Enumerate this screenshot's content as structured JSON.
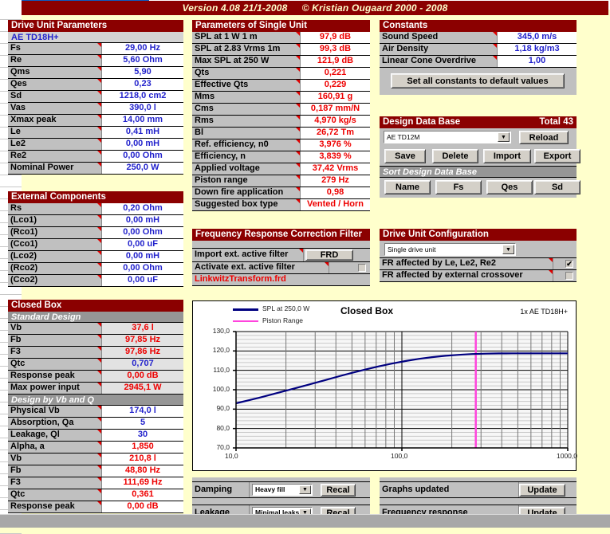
{
  "titlebar": {
    "version": "Version 4.08  21/1-2008",
    "copyright": "©  Kristian Ougaard  2000 - 2008"
  },
  "drive_unit_parameters": {
    "header": "Drive Unit Parameters",
    "unit_name": "AE TD18H+",
    "rows": [
      {
        "label": "Fs",
        "value": "29,00 Hz"
      },
      {
        "label": "Re",
        "value": "5,60 Ohm"
      },
      {
        "label": "Qms",
        "value": "5,90"
      },
      {
        "label": "Qes",
        "value": "0,23"
      },
      {
        "label": "Sd",
        "value": "1218,0 cm2"
      },
      {
        "label": "Vas",
        "value": "390,0 l"
      },
      {
        "label": "Xmax peak",
        "value": "14,00 mm"
      },
      {
        "label": "Le",
        "value": "0,41 mH"
      },
      {
        "label": "Le2",
        "value": "0,00 mH"
      },
      {
        "label": "Re2",
        "value": "0,00 Ohm"
      },
      {
        "label": "Nominal Power",
        "value": "250,0 W"
      }
    ]
  },
  "external_components": {
    "header": "External Components",
    "rows": [
      {
        "label": "Rs",
        "value": "0,20 Ohm"
      },
      {
        "label": "(Lco1)",
        "value": "0,00 mH"
      },
      {
        "label": "(Rco1)",
        "value": "0,00 Ohm"
      },
      {
        "label": "(Cco1)",
        "value": "0,00 uF"
      },
      {
        "label": "(Lco2)",
        "value": "0,00 mH"
      },
      {
        "label": "(Rco2)",
        "value": "0,00 Ohm"
      },
      {
        "label": "(Cco2)",
        "value": "0,00 uF"
      }
    ]
  },
  "closed_box": {
    "header": "Closed Box",
    "section_standard": "Standard Design",
    "standard_rows": [
      {
        "label": "Vb",
        "value": "37,6 l"
      },
      {
        "label": "Fb",
        "value": "97,85 Hz"
      },
      {
        "label": "F3",
        "value": "97,86 Hz"
      },
      {
        "label": "Qtc",
        "value": "0,707"
      },
      {
        "label": "Response peak",
        "value": "0,00 dB"
      },
      {
        "label": "Max power input",
        "value": "2945,1 W"
      }
    ],
    "section_design": "Design by Vb and Q",
    "design_rows": [
      {
        "label": "Physical Vb",
        "value": "174,0 l"
      },
      {
        "label": "Absorption, Qa",
        "value": "5"
      },
      {
        "label": "Leakage, Ql",
        "value": "30"
      },
      {
        "label": "Alpha, a",
        "value": "1,850"
      },
      {
        "label": "Vb",
        "value": "210,8 l"
      },
      {
        "label": "Fb",
        "value": "48,80 Hz"
      },
      {
        "label": "F3",
        "value": "111,69 Hz"
      },
      {
        "label": "Qtc",
        "value": "0,361"
      },
      {
        "label": "Response peak",
        "value": "0,00 dB"
      }
    ]
  },
  "single_unit": {
    "header": "Parameters of Single Unit",
    "rows": [
      {
        "label": "SPL at 1 W 1 m",
        "value": "97,9 dB"
      },
      {
        "label": "SPL at 2.83 Vrms 1m",
        "value": "99,3 dB"
      },
      {
        "label": "Max SPL at 250 W",
        "value": "121,9 dB"
      },
      {
        "label": "Qts",
        "value": "0,221"
      },
      {
        "label": "Effective Qts",
        "value": "0,229"
      },
      {
        "label": "Mms",
        "value": "160,91 g"
      },
      {
        "label": "Cms",
        "value": "0,187 mm/N"
      },
      {
        "label": "Rms",
        "value": "4,970 kg/s"
      },
      {
        "label": "Bl",
        "value": "26,72 Tm"
      },
      {
        "label": "Ref. efficiency, n0",
        "value": "3,976 %"
      },
      {
        "label": "Efficiency, n",
        "value": "3,839 %"
      },
      {
        "label": "Applied voltage",
        "value": "37,42 Vrms"
      },
      {
        "label": "Piston range",
        "value": "279 Hz"
      },
      {
        "label": "Down fire application",
        "value": "0,98"
      },
      {
        "label": "Suggested box type",
        "value": "Vented / Horn"
      }
    ]
  },
  "frcf": {
    "header": "Frequency Response Correction Filter",
    "import_label": "Import ext. active filter",
    "frd_button": "FRD",
    "activate_label": "Activate ext. active filter",
    "activate_checked": false,
    "filename": "LinkwitzTransform.frd"
  },
  "constants": {
    "header": "Constants",
    "rows": [
      {
        "label": "Sound Speed",
        "value": "345,0 m/s"
      },
      {
        "label": "Air Density",
        "value": "1,18 kg/m3"
      },
      {
        "label": "Linear Cone Overdrive",
        "value": "1,00"
      }
    ],
    "default_button": "Set all constants to default values"
  },
  "database": {
    "header": "Design Data Base",
    "total": "Total 43",
    "selected": "AE TD12M",
    "reload_button": "Reload",
    "buttons": [
      "Save",
      "Delete",
      "Import",
      "Export"
    ],
    "sort_header": "Sort Design Data Base",
    "sort_buttons": [
      "Name",
      "Fs",
      "Qes",
      "Sd"
    ]
  },
  "drive_unit_config": {
    "header": "Drive Unit Configuration",
    "selected": "Single drive unit",
    "check1_label": "FR affected by Le, Le2, Re2",
    "check1_checked": true,
    "check2_label": "FR affected by external crossover",
    "check2_checked": false
  },
  "bottom_controls": {
    "damping_label": "Damping",
    "damping_value": "Heavy fill",
    "damping_button": "Recal",
    "leakage_label": "Leakage",
    "leakage_value": "Minimal leaks",
    "leakage_button": "Recal",
    "graphs_label": "Graphs updated",
    "graphs_button": "Update",
    "freq_label": "Frequency response",
    "freq_button": "Update"
  },
  "chart_data": {
    "type": "line",
    "title": "Closed Box",
    "subtitle": "1x AE TD18H+",
    "xlabel": "",
    "ylabel": "",
    "xscale": "log",
    "xlim": [
      10.0,
      1000.0
    ],
    "ylim": [
      70.0,
      130.0
    ],
    "xticklabels": [
      "10,0",
      "100,0",
      "1000,0"
    ],
    "yticklabels": [
      "70,0",
      "80,0",
      "90,0",
      "100,0",
      "110,0",
      "120,0",
      "130,0"
    ],
    "grid": true,
    "legend_position": "top-left",
    "series": [
      {
        "name": "SPL at 250,0 W",
        "color": "#000080",
        "x": [
          10,
          12,
          14,
          17,
          20,
          24,
          29,
          35,
          42,
          50,
          60,
          72,
          87,
          105,
          126,
          152,
          183,
          220,
          265,
          320,
          385,
          465,
          560,
          675,
          810,
          1000
        ],
        "y": [
          93.0,
          94.6,
          96.0,
          97.9,
          99.5,
          101.3,
          103.2,
          105.1,
          107.0,
          108.7,
          110.4,
          112.0,
          113.5,
          114.8,
          115.9,
          116.8,
          117.5,
          118.0,
          118.4,
          118.6,
          118.75,
          118.8,
          118.8,
          118.8,
          118.8,
          118.8
        ]
      },
      {
        "name": "Piston Range",
        "color": "#ff44dd",
        "type": "vline",
        "x": 279
      }
    ]
  }
}
